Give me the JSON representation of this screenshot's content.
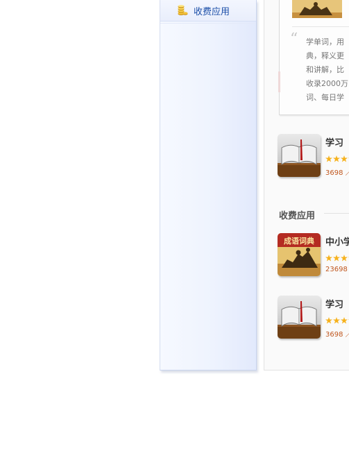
{
  "sidebar": {
    "items": [
      {
        "label": "收费应用",
        "icon": "coins-icon"
      }
    ]
  },
  "description": {
    "lines": [
      "学单词，用",
      "典，释义更",
      "和讲解，比",
      "收录2000万",
      "词、每日学"
    ]
  },
  "apps_top": [
    {
      "name": "学习",
      "count": "3698 ／",
      "rating": 3,
      "icon": "book-icon"
    }
  ],
  "paid_section": {
    "title": "收费应用",
    "apps": [
      {
        "name": "中小学",
        "count": "23698",
        "rating": 3,
        "icon": "idiom-dictionary-icon",
        "icon_text": "成语词典"
      },
      {
        "name": "学习",
        "count": "3698 ／",
        "rating": 3,
        "icon": "book-icon"
      }
    ]
  },
  "colors": {
    "link_blue": "#1b4ea8",
    "count_orange": "#c0561d",
    "star_yellow": "#f6b21d"
  }
}
